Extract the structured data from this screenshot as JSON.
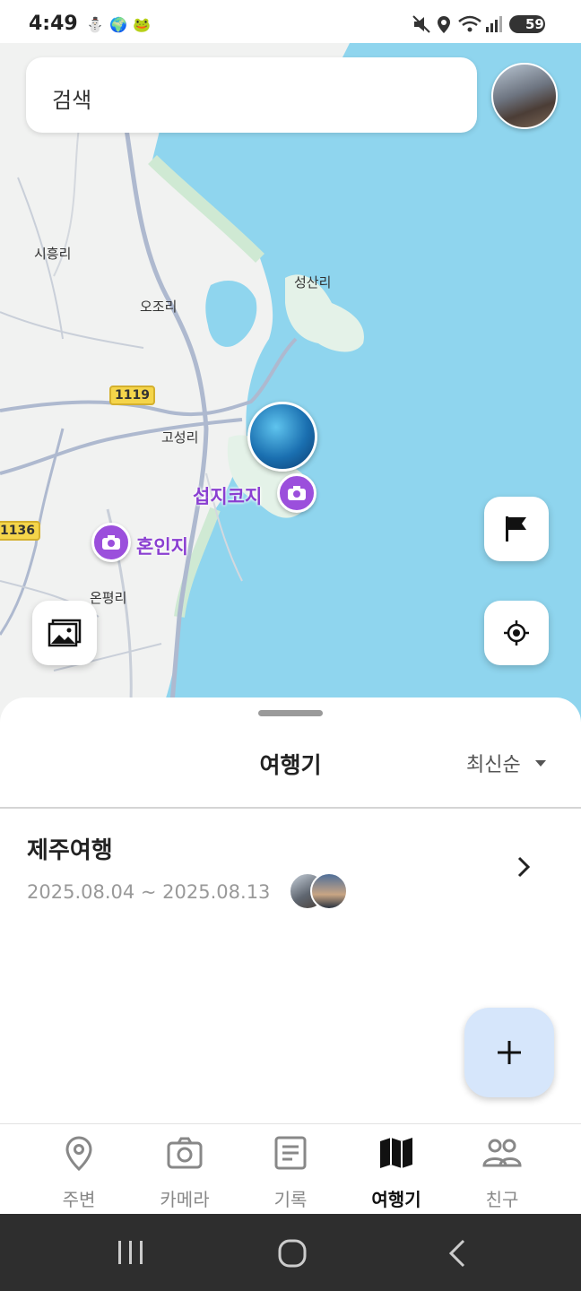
{
  "status_bar": {
    "time": "4:49",
    "battery": "59"
  },
  "search": {
    "placeholder": "검색"
  },
  "map": {
    "labels": {
      "sihungni": "시흥리",
      "ojori": "오조리",
      "seongsanri": "성산리",
      "goseongri": "고성리",
      "onpyeongri": "온평리",
      "road_1119": "1119",
      "road_1136": "1136"
    },
    "pois": {
      "seopjikoji": "섭지코지",
      "honinji": "혼인지"
    }
  },
  "sheet": {
    "title": "여행기",
    "sort_label": "최신순",
    "trips": [
      {
        "name": "제주여행",
        "dates": "2025.08.04 ~ 2025.08.13"
      }
    ]
  },
  "nav": {
    "items": [
      {
        "label": "주변",
        "icon": "location-pin-icon"
      },
      {
        "label": "카메라",
        "icon": "camera-icon"
      },
      {
        "label": "기록",
        "icon": "document-icon"
      },
      {
        "label": "여행기",
        "icon": "map-icon",
        "active": true
      },
      {
        "label": "친구",
        "icon": "friends-icon"
      }
    ]
  },
  "colors": {
    "sea": "#8fd5ee",
    "land": "#f1f2f1",
    "poi": "#9b4fdc",
    "fab": "#d6e6fb"
  }
}
